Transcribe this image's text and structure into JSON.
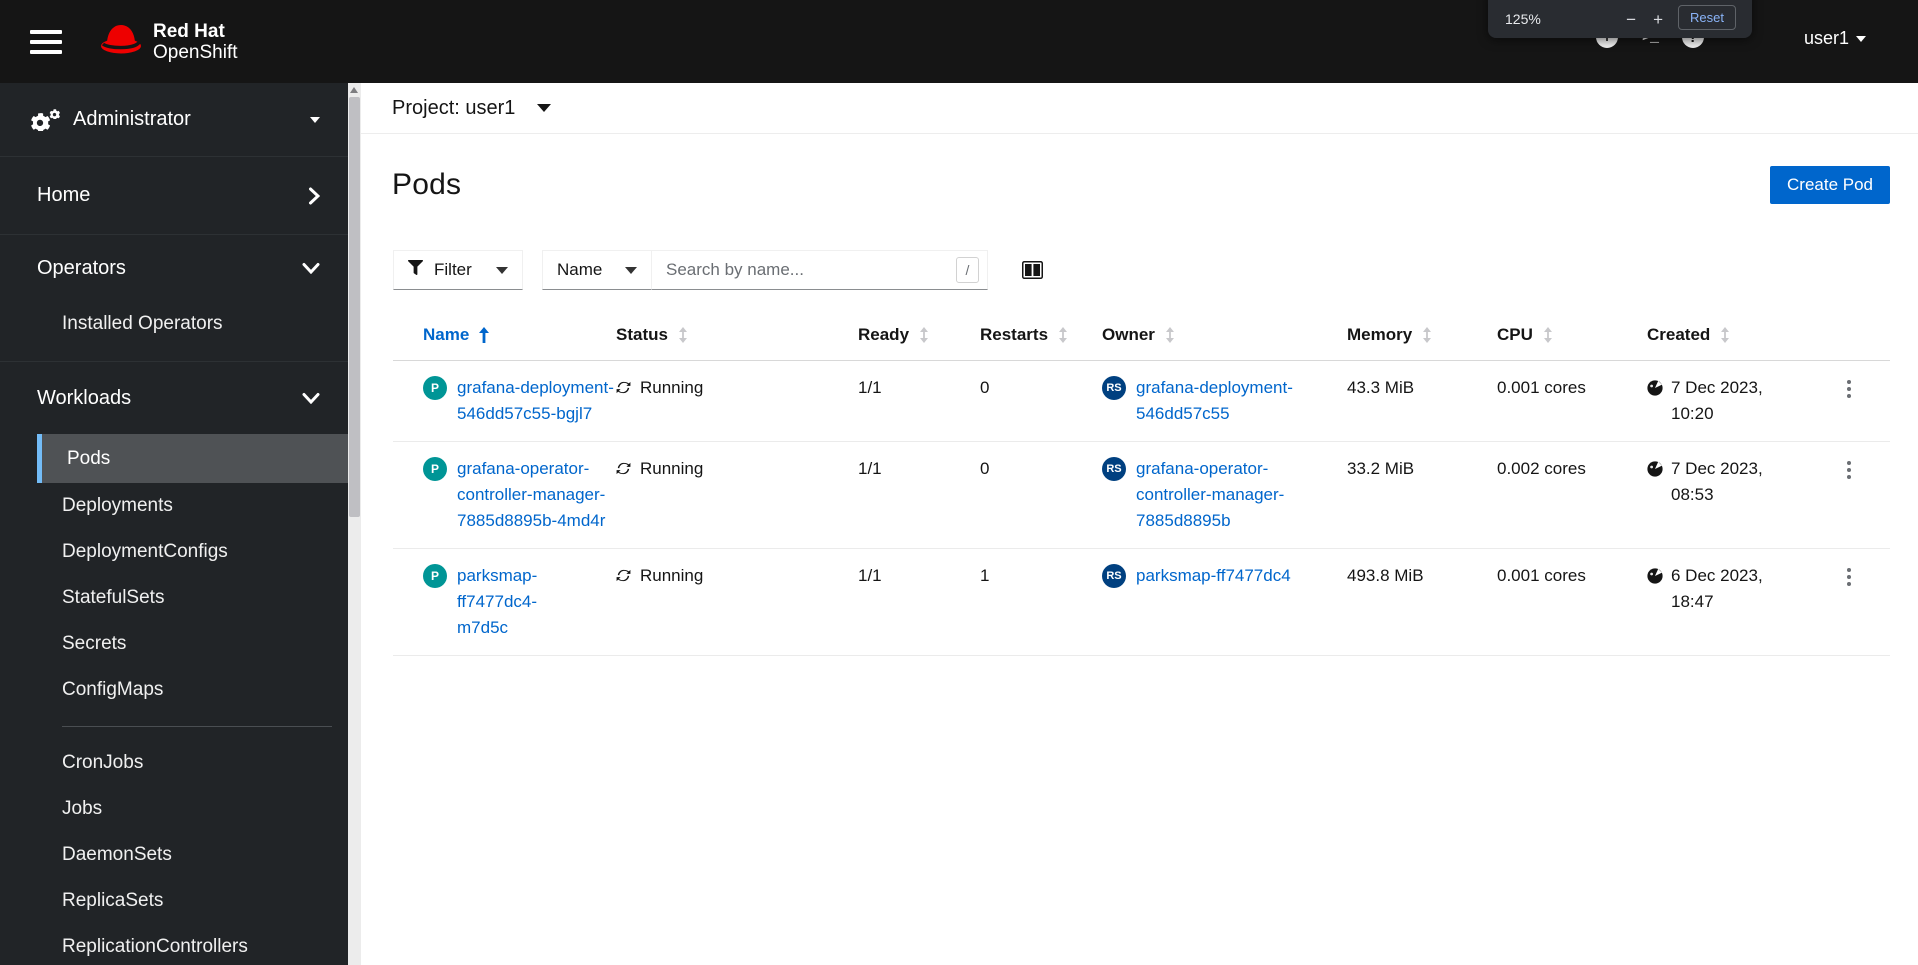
{
  "masthead": {
    "brand_line1": "Red Hat",
    "brand_line2": "OpenShift",
    "terminal_glyph": ">_",
    "plus_glyph": "+",
    "help_glyph": "?",
    "username": "user1"
  },
  "zoom_popup": {
    "level": "125%",
    "minus_label": "−",
    "plus_label": "+",
    "reset_label": "Reset"
  },
  "sidebar": {
    "perspective": "Administrator",
    "home": "Home",
    "operators": "Operators",
    "installed_operators": "Installed Operators",
    "workloads": "Workloads",
    "items_group1": [
      "Pods",
      "Deployments",
      "DeploymentConfigs",
      "StatefulSets",
      "Secrets",
      "ConfigMaps"
    ],
    "items_group2": [
      "CronJobs",
      "Jobs",
      "DaemonSets",
      "ReplicaSets",
      "ReplicationControllers"
    ],
    "selected_item": "Pods"
  },
  "project_bar": {
    "label": "Project: user1"
  },
  "page": {
    "title": "Pods",
    "create_button": "Create Pod"
  },
  "toolbar": {
    "filter_label": "Filter",
    "name_label": "Name",
    "search_placeholder": "Search by name...",
    "shortcut": "/"
  },
  "table": {
    "columns": [
      "Name",
      "Status",
      "Ready",
      "Restarts",
      "Owner",
      "Memory",
      "CPU",
      "Created"
    ],
    "sorted_column": "Name",
    "sort_direction": "ascending",
    "rows": [
      {
        "badge": "P",
        "name": "grafana-deployment-546dd57c55-bgjl7",
        "name_lines": [
          "grafana-deployment-",
          "546dd57c55-bgjl7"
        ],
        "status": "Running",
        "ready": "1/1",
        "restarts": "0",
        "owner_badge": "RS",
        "owner": "grafana-deployment-546dd57c55",
        "owner_lines": [
          "grafana-deployment-",
          "546dd57c55"
        ],
        "memory": "43.3 MiB",
        "cpu": "0.001 cores",
        "created": "7 Dec 2023, 10:20",
        "created_lines": [
          "7 Dec 2023,",
          "10:20"
        ]
      },
      {
        "badge": "P",
        "name": "grafana-operator-controller-manager-7885d8895b-4md4r",
        "name_lines": [
          "grafana-operator-",
          "controller-manager-",
          "7885d8895b-4md4r"
        ],
        "status": "Running",
        "ready": "1/1",
        "restarts": "0",
        "owner_badge": "RS",
        "owner": "grafana-operator-controller-manager-7885d8895b",
        "owner_lines": [
          "grafana-operator-",
          "controller-manager-",
          "7885d8895b"
        ],
        "memory": "33.2 MiB",
        "cpu": "0.002 cores",
        "created": "7 Dec 2023, 08:53",
        "created_lines": [
          "7 Dec 2023,",
          "08:53"
        ]
      },
      {
        "badge": "P",
        "name": "parksmap-ff7477dc4-m7d5c",
        "name_lines": [
          "parksmap-ff7477dc4-",
          "m7d5c"
        ],
        "status": "Running",
        "ready": "1/1",
        "restarts": "1",
        "owner_badge": "RS",
        "owner": "parksmap-ff7477dc4",
        "owner_lines": [
          "parksmap-ff7477dc4"
        ],
        "memory": "493.8 MiB",
        "cpu": "0.001 cores",
        "created": "6 Dec 2023, 18:47",
        "created_lines": [
          "6 Dec 2023,",
          "18:47"
        ]
      }
    ]
  },
  "colors": {
    "accent": "#0066cc",
    "masthead_bg": "#151515",
    "sidebar_bg": "#212427",
    "selected_nav_bg": "#4f5255",
    "selected_nav_border": "#73bcf7",
    "pod_badge": "#009596",
    "replicaset_badge": "#004080",
    "link": "#0066cc",
    "brand_red": "#ee0000"
  }
}
